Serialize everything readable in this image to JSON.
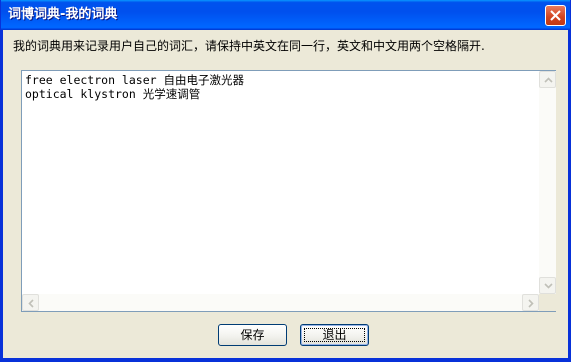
{
  "window": {
    "title": "词博词典-我的词典"
  },
  "instruction": "我的词典用来记录用户自己的词汇，请保持中英文在同一行，英文和中文用两个空格隔开.",
  "editor": {
    "content": "free electron laser 自由电子激光器\noptical klystron 光学速调管"
  },
  "buttons": {
    "save_label": "保存",
    "exit_label": "退出"
  },
  "icons": {
    "close": "close-icon",
    "up": "arrow-up-icon",
    "down": "arrow-down-icon",
    "left": "arrow-left-icon",
    "right": "arrow-right-icon"
  },
  "colors": {
    "title_bar": "#0050ee",
    "close_button": "#d1431f",
    "dialog_bg": "#ece9d8"
  }
}
